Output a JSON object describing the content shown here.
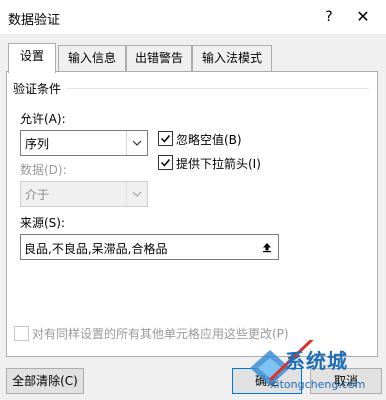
{
  "window": {
    "title": "数据验证",
    "help": "?",
    "close": "✕"
  },
  "tabs": [
    {
      "label": "设置",
      "active": true
    },
    {
      "label": "输入信息",
      "active": false
    },
    {
      "label": "出错警告",
      "active": false
    },
    {
      "label": "输入法模式",
      "active": false
    }
  ],
  "validation": {
    "group_title": "验证条件",
    "allow_label": "允许(A):",
    "allow_value": "序列",
    "data_label": "数据(D):",
    "data_value": "介于",
    "ignore_blank_label": "忽略空值(B)",
    "ignore_blank_checked": true,
    "dropdown_label": "提供下拉箭头(I)",
    "dropdown_checked": true,
    "source_label": "来源(S):",
    "source_value": "良品,不良品,呆滞品,合格品"
  },
  "apply_all_label": "对有同样设置的所有其他单元格应用这些更改(P)",
  "apply_all_checked": false,
  "buttons": {
    "clear_all": "全部清除(C)",
    "ok": "确定",
    "cancel": "取消"
  },
  "watermark": {
    "text": "系统城",
    "url": "xitongcheng.com"
  }
}
